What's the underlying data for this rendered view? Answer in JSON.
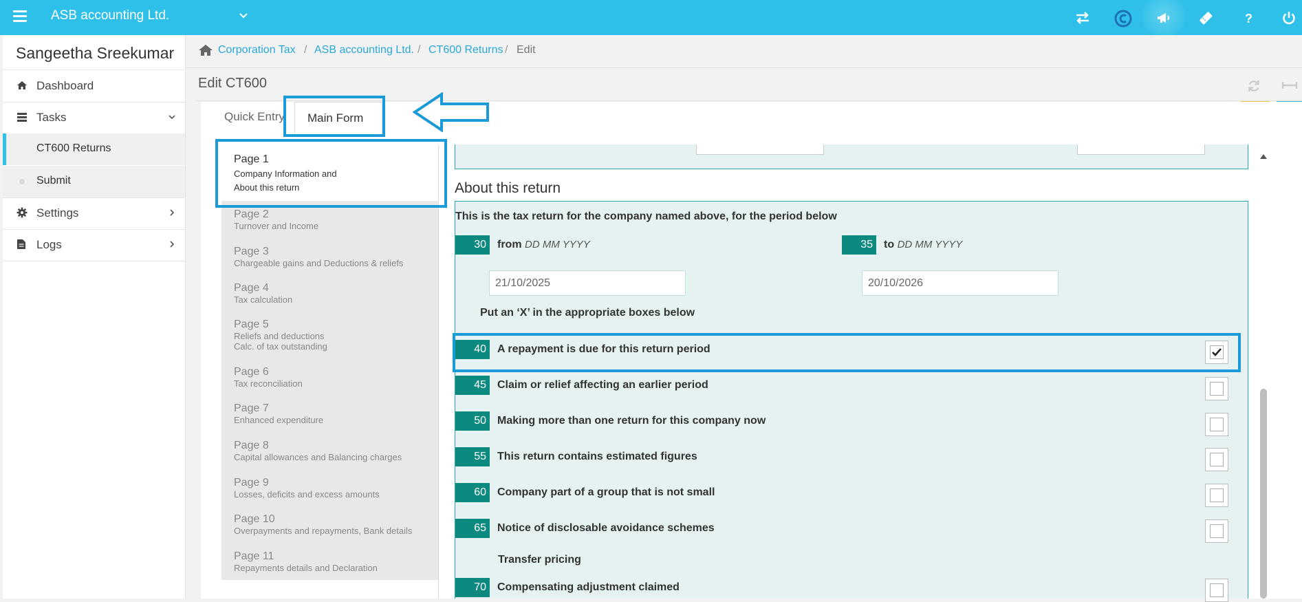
{
  "topbar": {
    "company": "ASB accounting Ltd.",
    "icons": [
      "menu-icon",
      "chevron-down-icon",
      "swap-arrows-icon",
      "brand-c-icon",
      "megaphone-icon",
      "ticket-icon",
      "help-icon",
      "power-icon"
    ]
  },
  "sidebar": {
    "user": "Sangeetha Sreekumar",
    "items": [
      {
        "label": "Dashboard",
        "icon": "home-icon"
      },
      {
        "label": "Tasks",
        "icon": "tasks-icon",
        "expanded": true
      },
      {
        "label": "CT600 Returns",
        "active": true
      },
      {
        "label": "Submit"
      },
      {
        "label": "Settings",
        "icon": "gear-icon"
      },
      {
        "label": "Logs",
        "icon": "document-icon"
      }
    ]
  },
  "breadcrumb": {
    "items": [
      "Corporation Tax",
      "ASB accounting Ltd.",
      "CT600 Returns"
    ],
    "separator": "/",
    "current": "Edit"
  },
  "page": {
    "title": "Edit CT600"
  },
  "tabs": {
    "quick": "Quick Entry",
    "main": "Main Form",
    "active": "Main Form"
  },
  "pages": [
    {
      "title": "Page 1",
      "subtitle": "Company Information and",
      "subtitle2": "About this return",
      "active": true
    },
    {
      "title": "Page 2",
      "subtitle": "Turnover and Income"
    },
    {
      "title": "Page 3",
      "subtitle": "Chargeable gains and Deductions & reliefs"
    },
    {
      "title": "Page 4",
      "subtitle": "Tax calculation"
    },
    {
      "title": "Page 5",
      "subtitle": "Reliefs and deductions",
      "subtitle2": "Calc. of tax outstanding"
    },
    {
      "title": "Page 6",
      "subtitle": "Tax reconciliation"
    },
    {
      "title": "Page 7",
      "subtitle": "Enhanced expenditure"
    },
    {
      "title": "Page 8",
      "subtitle": "Capital allowances and Balancing charges"
    },
    {
      "title": "Page 9",
      "subtitle": "Losses, deficits and excess amounts"
    },
    {
      "title": "Page 10",
      "subtitle": "Overpayments and repayments, Bank details"
    },
    {
      "title": "Page 11",
      "subtitle": "Repayments details and Declaration"
    }
  ],
  "form": {
    "section_title": "About this return",
    "intro": "This is the tax return for the company named above, for the period below",
    "from": {
      "box": "30",
      "label": "from",
      "format": "DD MM YYYY",
      "value": "21/10/2025"
    },
    "to": {
      "box": "35",
      "label": "to",
      "format": "DD MM YYYY",
      "value": "20/10/2026"
    },
    "put_x": "Put an ‘X’ in the appropriate boxes below",
    "rows": [
      {
        "box": "40",
        "label": "A repayment is due for this return period",
        "checked": true
      },
      {
        "box": "45",
        "label": "Claim or relief affecting an earlier period",
        "checked": false
      },
      {
        "box": "50",
        "label": "Making more than one return for this company now",
        "checked": false
      },
      {
        "box": "55",
        "label": "This return contains estimated figures",
        "checked": false
      },
      {
        "box": "60",
        "label": "Company part of a group that is not small",
        "checked": false
      },
      {
        "box": "65",
        "label": "Notice of disclosable avoidance schemes",
        "checked": false
      }
    ],
    "transfer_pricing": "Transfer pricing",
    "row70": {
      "box": "70",
      "label": "Compensating adjustment claimed",
      "checked": false
    }
  }
}
